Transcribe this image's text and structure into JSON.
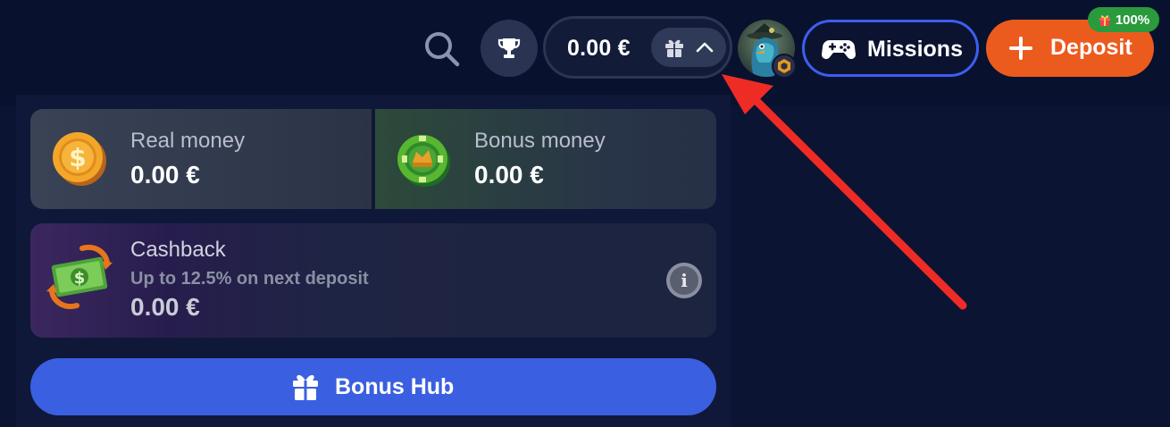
{
  "header": {
    "balance": "0.00 €",
    "missions_label": "Missions",
    "deposit_label": "Deposit",
    "promo_badge": "100%"
  },
  "wallet": {
    "real_money": {
      "title": "Real money",
      "amount": "0.00 €"
    },
    "bonus_money": {
      "title": "Bonus money",
      "amount": "0.00 €"
    },
    "cashback": {
      "title": "Cashback",
      "subtitle": "Up to 12.5% on next deposit",
      "amount": "0.00 €"
    },
    "bonus_hub_label": "Bonus Hub"
  },
  "icons": {
    "search": "search-icon",
    "trophy": "trophy-icon",
    "gift": "gift-icon",
    "chevron": "chevron-up-icon",
    "gamepad": "gamepad-icon",
    "plus": "plus-icon",
    "info": "info-icon",
    "coin": "gold-coin-icon",
    "chip": "green-chip-icon",
    "cashback": "cashback-money-icon"
  },
  "colors": {
    "deposit": "#ec5b1e",
    "missions_border": "#3d5ef2",
    "bonus_hub": "#3a5fe0",
    "promo_badge": "#2a9a3c",
    "annotation_arrow": "#ef2b25"
  }
}
